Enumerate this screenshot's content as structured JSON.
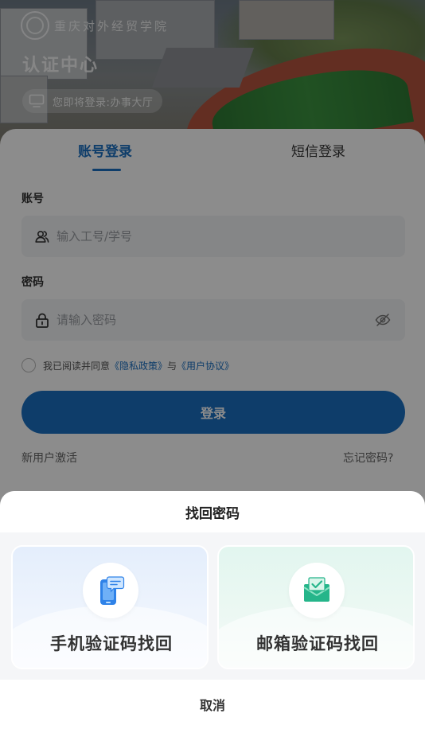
{
  "header": {
    "university_name": "重庆对外经贸学院",
    "title": "认证中心",
    "entry_text": "您即将登录:办事大厅"
  },
  "tabs": [
    {
      "label": "账号登录",
      "active": true
    },
    {
      "label": "短信登录",
      "active": false
    }
  ],
  "form": {
    "account_label": "账号",
    "account_placeholder": "输入工号/学号",
    "account_value": "",
    "password_label": "密码",
    "password_placeholder": "请输入密码",
    "password_value": "",
    "agree_prefix": "我已阅读并同意",
    "privacy_link": "《隐私政策》",
    "agree_and": "与",
    "terms_link": "《用户协议》",
    "agreed": false,
    "login_label": "登录",
    "activate_label": "新用户激活",
    "forgot_label": "忘记密码?"
  },
  "sheet": {
    "title": "找回密码",
    "options": [
      {
        "label": "手机验证码找回",
        "icon": "phone-message-icon"
      },
      {
        "label": "邮箱验证码找回",
        "icon": "mail-check-icon"
      }
    ],
    "cancel_label": "取消"
  },
  "colors": {
    "accent": "#1a6fc2",
    "phone_icon": "#2f82e8",
    "email_icon": "#25b58a"
  }
}
